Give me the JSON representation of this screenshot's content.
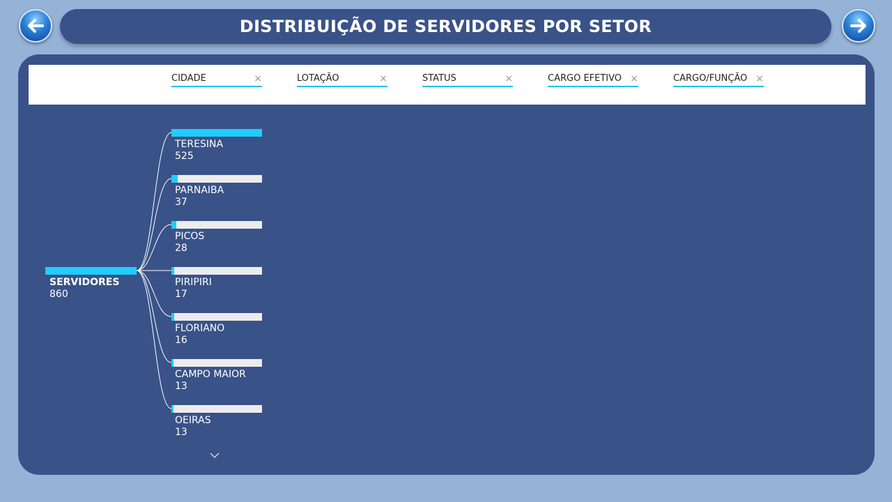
{
  "header": {
    "title": "DISTRIBUIÇÃO DE SERVIDORES POR SETOR",
    "prev_icon": "arrow-left-icon",
    "next_icon": "arrow-right-icon"
  },
  "filters": [
    {
      "label": "CIDADE"
    },
    {
      "label": "LOTAÇÃO"
    },
    {
      "label": "STATUS"
    },
    {
      "label": "CARGO EFETIVO"
    },
    {
      "label": "CARGO/FUNÇÃO"
    }
  ],
  "filter_clear_symbol": "×",
  "colors": {
    "background": "#95b3d7",
    "panel": "#395288",
    "accent": "#20cdfb",
    "bar_track": "#ececec"
  },
  "tree": {
    "root": {
      "label": "SERVIDORES",
      "value": "860"
    },
    "children": [
      {
        "label": "TERESINA",
        "value": "525"
      },
      {
        "label": "PARNAIBA",
        "value": "37"
      },
      {
        "label": "PICOS",
        "value": "28"
      },
      {
        "label": "PIRIPIRI",
        "value": "17"
      },
      {
        "label": "FLORIANO",
        "value": "16"
      },
      {
        "label": "CAMPO MAIOR",
        "value": "13"
      },
      {
        "label": "OEIRAS",
        "value": "13"
      }
    ],
    "more_icon": "chevron-down-icon"
  }
}
